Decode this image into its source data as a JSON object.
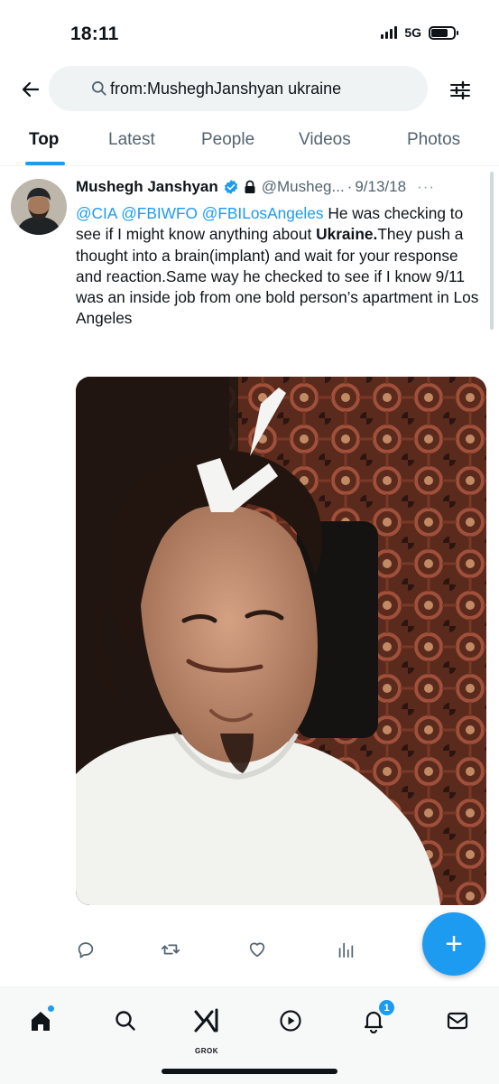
{
  "status_bar": {
    "time": "18:11",
    "network": "5G",
    "battery_level": 0.75
  },
  "search": {
    "query": "from:MusheghJanshyan ukraine",
    "icons": {
      "back": "arrow-left-icon",
      "search": "search-icon",
      "filter": "sliders-icon"
    }
  },
  "tabs": [
    {
      "label": "Top",
      "active": true
    },
    {
      "label": "Latest",
      "active": false
    },
    {
      "label": "People",
      "active": false
    },
    {
      "label": "Videos",
      "active": false
    },
    {
      "label": "Photos",
      "active": false
    }
  ],
  "tweet": {
    "author_name": "Mushegh Janshyan",
    "handle": "@Musheg...",
    "separator": "·",
    "date": "9/13/18",
    "more": "···",
    "mentions": [
      "@CIA",
      "@FBIWFO",
      "@FBILosAngeles"
    ],
    "text_part1": " He was checking to see if I might know anything about ",
    "text_bold": "Ukraine.",
    "text_part2": "They push a thought into a brain(implant) and wait for your response and reaction.Same way he checked to see if I know 9/11 was an inside job from one bold person’s apartment in Los Angeles",
    "actions": [
      "reply-icon",
      "retweet-icon",
      "like-icon",
      "views-icon"
    ]
  },
  "fab": {
    "label": "+"
  },
  "bottom_nav": {
    "items": [
      "home-icon",
      "search-icon",
      "grok-icon",
      "video-icon",
      "notifications-icon",
      "messages-icon"
    ],
    "grok_label": "GROK",
    "notifications_count": "1"
  },
  "colors": {
    "accent": "#1d9bf0",
    "text_primary": "#0f1419",
    "text_secondary": "#536471"
  }
}
